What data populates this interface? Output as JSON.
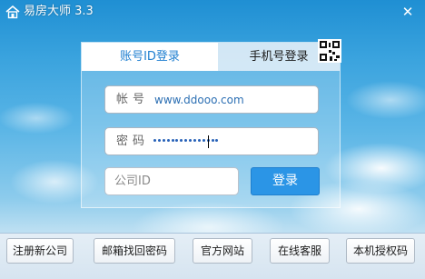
{
  "window": {
    "title": "易房大师",
    "version": "3.3",
    "close_glyph": "✕"
  },
  "login": {
    "tabs": [
      {
        "label": "账号ID登录",
        "active": true
      },
      {
        "label": "手机号登录",
        "active": false
      }
    ],
    "username": {
      "label": "帐号",
      "value": "www.ddooo.com"
    },
    "password": {
      "label": "密码",
      "masked_length": 15
    },
    "company": {
      "placeholder": "公司ID",
      "value": ""
    },
    "login_button": "登录",
    "qr_icon": "qr-code-icon"
  },
  "footer": {
    "buttons": [
      "注册新公司",
      "邮箱找回密码",
      "官方网站",
      "在线客服",
      "本机授权码"
    ]
  },
  "colors": {
    "accent": "#2b95e6",
    "active_tab_text": "#1f7fd0",
    "sky_top": "#1f8fd3"
  }
}
